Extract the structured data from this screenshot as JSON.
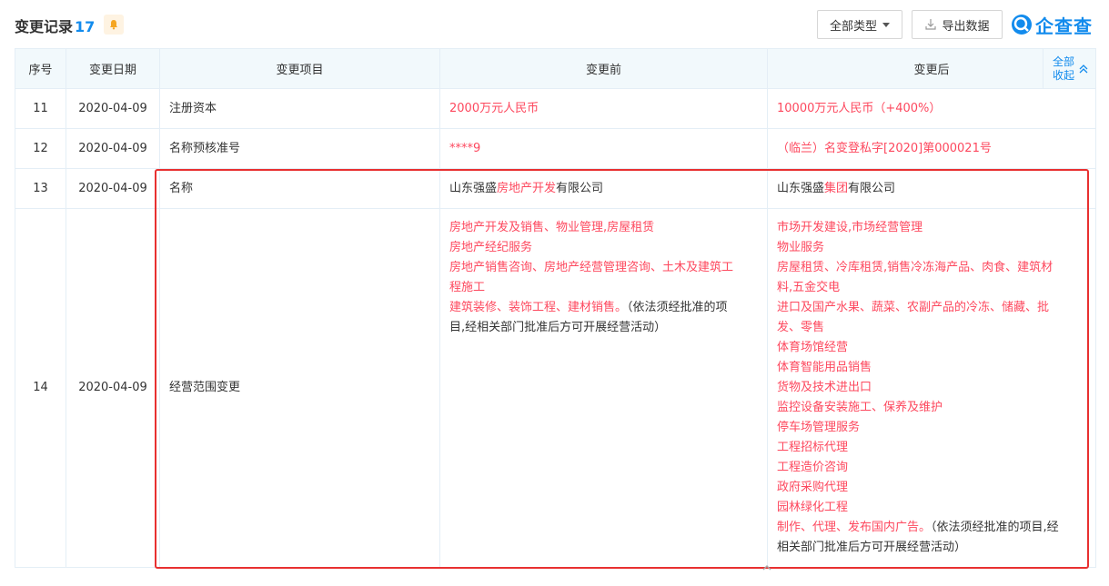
{
  "header": {
    "title": "变更记录",
    "count": "17",
    "type_filter_label": "全部类型",
    "export_label": "导出数据",
    "logo_text": "企查查"
  },
  "table": {
    "columns": [
      "序号",
      "变更日期",
      "变更项目",
      "变更前",
      "变更后"
    ],
    "collapse_label_1": "全部",
    "collapse_label_2": "收起",
    "rows": [
      {
        "no": "11",
        "date": "2020-04-09",
        "item": "注册资本",
        "before": "2000万元人民币",
        "after": "10000万元人民币（+400%）"
      },
      {
        "no": "12",
        "date": "2020-04-09",
        "item": "名称预核准号",
        "before": "****9",
        "after": "（临兰）名变登私字[2020]第000021号"
      },
      {
        "no": "13",
        "date": "2020-04-09",
        "item": "名称",
        "before_prefix": "山东强盛",
        "before_highlight": "房地产开发",
        "before_suffix": "有限公司",
        "after_prefix": "山东强盛",
        "after_highlight": "集团",
        "after_suffix": "有限公司"
      },
      {
        "no": "14",
        "date": "2020-04-09",
        "item": "经营范围变更",
        "before_lines": [
          "房地产开发及销售、物业管理,房屋租赁",
          "房地产经纪服务",
          "房地产销售咨询、房地产经营管理咨询、土木及建筑工",
          "程施工",
          "建筑装修、装饰工程、建材销售。"
        ],
        "before_tail_1": "（依法须经批准的项",
        "before_tail_2": "目,经相关部门批准后方可开展经营活动）",
        "after_lines": [
          "市场开发建设,市场经营管理",
          "物业服务",
          "房屋租赁、冷库租赁,销售冷冻海产品、肉食、建筑材",
          "料,五金交电",
          "进口及国产水果、蔬菜、农副产品的冷冻、储藏、批",
          "发、零售",
          "体育场馆经营",
          "体育智能用品销售",
          "货物及技术进出口",
          "监控设备安装施工、保养及维护",
          "停车场管理服务",
          "工程招标代理",
          "工程造价咨询",
          "政府采购代理",
          "园林绿化工程"
        ],
        "after_red_last": "制作、代理、发布国内广告。",
        "after_tail_1": "（依法须经批准的项目,经",
        "after_tail_2": "相关部门批准后方可开展经营活动）"
      }
    ]
  },
  "colors": {
    "accent": "#128bed",
    "changed_text": "#fd485e",
    "highlight_box": "#e83030",
    "header_bg": "#f2f9fc"
  }
}
